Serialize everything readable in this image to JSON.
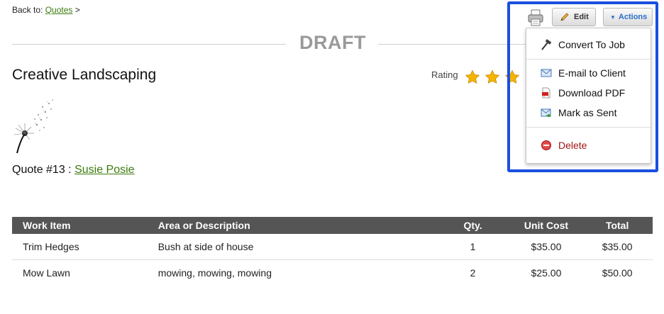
{
  "breadcrumb": {
    "prefix": "Back to:",
    "link": "Quotes",
    "suffix": ">"
  },
  "status": {
    "label": "DRAFT"
  },
  "client": {
    "name": "Creative Landscaping"
  },
  "rating": {
    "label": "Rating",
    "stars_shown": 3
  },
  "quote": {
    "prefix": "Quote #13 :",
    "contact": "Susie Posie"
  },
  "toolbar": {
    "print_icon": "printer-icon",
    "edit_label": "Edit",
    "actions_label": "Actions"
  },
  "actions_menu": {
    "items": [
      {
        "label": "Convert To Job",
        "icon": "hammer-icon"
      },
      {
        "label": "E-mail to Client",
        "icon": "envelope-icon"
      },
      {
        "label": "Download PDF",
        "icon": "pdf-icon"
      },
      {
        "label": "Mark as Sent",
        "icon": "sent-mail-icon"
      },
      {
        "label": "Delete",
        "icon": "delete-icon"
      }
    ]
  },
  "table": {
    "headers": [
      "Work Item",
      "Area or Description",
      "Qty.",
      "Unit Cost",
      "Total"
    ],
    "rows": [
      [
        "Trim Hedges",
        "Bush at side of house",
        "1",
        "$35.00",
        "$35.00"
      ],
      [
        "Mow Lawn",
        "mowing, mowing, mowing",
        "2",
        "$25.00",
        "$50.00"
      ]
    ]
  },
  "colors": {
    "link": "#3a7a0c",
    "header_bg": "#555555",
    "highlight": "#1a4fe0",
    "actions_text": "#2a6fc9",
    "delete_text": "#a01515",
    "star": "#f4b400"
  }
}
